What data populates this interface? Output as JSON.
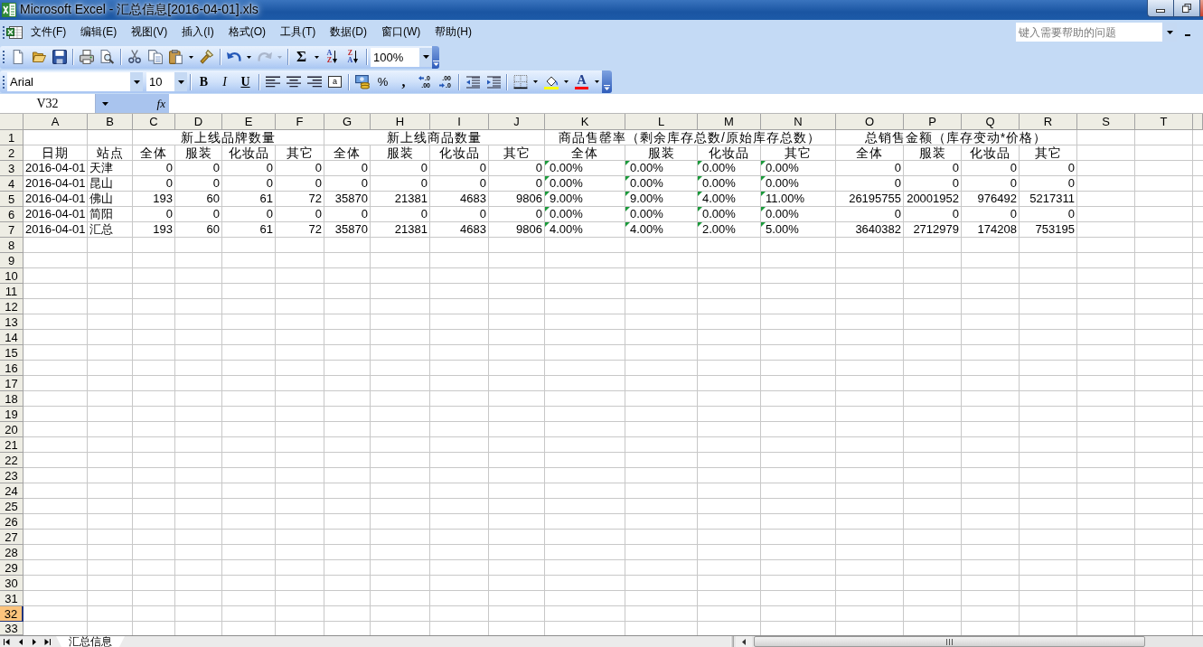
{
  "window": {
    "title": "Microsoft Excel - 汇总信息[2016-04-01].xls"
  },
  "menu_bar": {
    "items": [
      "文件(F)",
      "编辑(E)",
      "视图(V)",
      "插入(I)",
      "格式(O)",
      "工具(T)",
      "数据(D)",
      "窗口(W)",
      "帮助(H)"
    ],
    "help_box": {
      "placeholder": "键入需要帮助的问题"
    }
  },
  "standard_toolbar": {
    "redo": {
      "disabled": true
    },
    "sum": "Σ",
    "sort_ascending": [
      "A",
      "Z"
    ],
    "sort_descending": [
      "Z",
      "A"
    ],
    "zoom": "100%"
  },
  "formatting_toolbar": {
    "font": "Arial",
    "size": "10",
    "bold": "B",
    "italic": "I",
    "underline": "U",
    "merge": "a",
    "percent": "%",
    "comma": ",",
    "increase_decimal": [
      ".0",
      ".00"
    ],
    "decrease_decimal": [
      ".00",
      ".0"
    ],
    "font_color": "A"
  },
  "formula_bar": {
    "name_box": "V32",
    "function_label": "fx"
  },
  "sheet": {
    "column_letters": [
      "A",
      "B",
      "C",
      "D",
      "E",
      "F",
      "G",
      "H",
      "I",
      "J",
      "K",
      "L",
      "M",
      "N",
      "O",
      "P",
      "Q",
      "R",
      "S",
      "T"
    ],
    "row_headers": [
      {
        "label": "1",
        "selected": false
      },
      {
        "label": "2",
        "selected": false
      },
      {
        "label": "3",
        "selected": false
      },
      {
        "label": "4",
        "selected": false
      },
      {
        "label": "5",
        "selected": false
      },
      {
        "label": "6",
        "selected": false
      },
      {
        "label": "7",
        "selected": false
      },
      {
        "label": "8",
        "selected": false
      },
      {
        "label": "9",
        "selected": false
      },
      {
        "label": "10",
        "selected": false
      },
      {
        "label": "11",
        "selected": false
      },
      {
        "label": "12",
        "selected": false
      },
      {
        "label": "13",
        "selected": false
      },
      {
        "label": "14",
        "selected": false
      },
      {
        "label": "15",
        "selected": false
      },
      {
        "label": "16",
        "selected": false
      },
      {
        "label": "17",
        "selected": false
      },
      {
        "label": "18",
        "selected": false
      },
      {
        "label": "19",
        "selected": false
      },
      {
        "label": "20",
        "selected": false
      },
      {
        "label": "21",
        "selected": false
      },
      {
        "label": "22",
        "selected": false
      },
      {
        "label": "23",
        "selected": false
      },
      {
        "label": "24",
        "selected": false
      },
      {
        "label": "25",
        "selected": false
      },
      {
        "label": "26",
        "selected": false
      },
      {
        "label": "27",
        "selected": false
      },
      {
        "label": "28",
        "selected": false
      },
      {
        "label": "29",
        "selected": false
      },
      {
        "label": "30",
        "selected": false
      },
      {
        "label": "31",
        "selected": false
      },
      {
        "label": "32",
        "selected": true
      },
      {
        "label": "33",
        "selected": false
      }
    ],
    "header": [
      {
        "label": "日期",
        "kind": "text"
      },
      {
        "label": "站点",
        "kind": "text"
      },
      {
        "title": "新上线品牌数量",
        "kind": "number",
        "children": [
          "全体",
          "服装",
          "化妆品",
          "其它"
        ]
      },
      {
        "title": "新上线商品数量",
        "kind": "number",
        "children": [
          "全体",
          "服装",
          "化妆品",
          "其它"
        ]
      },
      {
        "title": "商品售罄率（剩余库存总数/原始库存总数）",
        "kind": "number_as_text",
        "children": [
          "全体",
          "服装",
          "化妆品",
          "其它"
        ]
      },
      {
        "title": "总销售金额（库存变动*价格）",
        "kind": "number",
        "children": [
          "全体",
          "服装",
          "化妆品",
          "其它"
        ]
      }
    ],
    "rows": [
      [
        "2016-04-01",
        "天津",
        "0",
        "0",
        "0",
        "0",
        "0",
        "0",
        "0",
        "0",
        "0.00%",
        "0.00%",
        "0.00%",
        "0.00%",
        "0",
        "0",
        "0",
        "0"
      ],
      [
        "2016-04-01",
        "昆山",
        "0",
        "0",
        "0",
        "0",
        "0",
        "0",
        "0",
        "0",
        "0.00%",
        "0.00%",
        "0.00%",
        "0.00%",
        "0",
        "0",
        "0",
        "0"
      ],
      [
        "2016-04-01",
        "佛山",
        "193",
        "60",
        "61",
        "72",
        "35870",
        "21381",
        "4683",
        "9806",
        "9.00%",
        "9.00%",
        "4.00%",
        "11.00%",
        "26195755",
        "20001952",
        "976492",
        "5217311"
      ],
      [
        "2016-04-01",
        "简阳",
        "0",
        "0",
        "0",
        "0",
        "0",
        "0",
        "0",
        "0",
        "0.00%",
        "0.00%",
        "0.00%",
        "0.00%",
        "0",
        "0",
        "0",
        "0"
      ],
      [
        "2016-04-01",
        "汇总",
        "193",
        "60",
        "61",
        "72",
        "35870",
        "21381",
        "4683",
        "9806",
        "4.00%",
        "4.00%",
        "2.00%",
        "5.00%",
        "3640382",
        "2712979",
        "174208",
        "753195"
      ]
    ]
  },
  "sheet_tabs": [
    {
      "label": "汇总信息",
      "selected": true
    }
  ]
}
